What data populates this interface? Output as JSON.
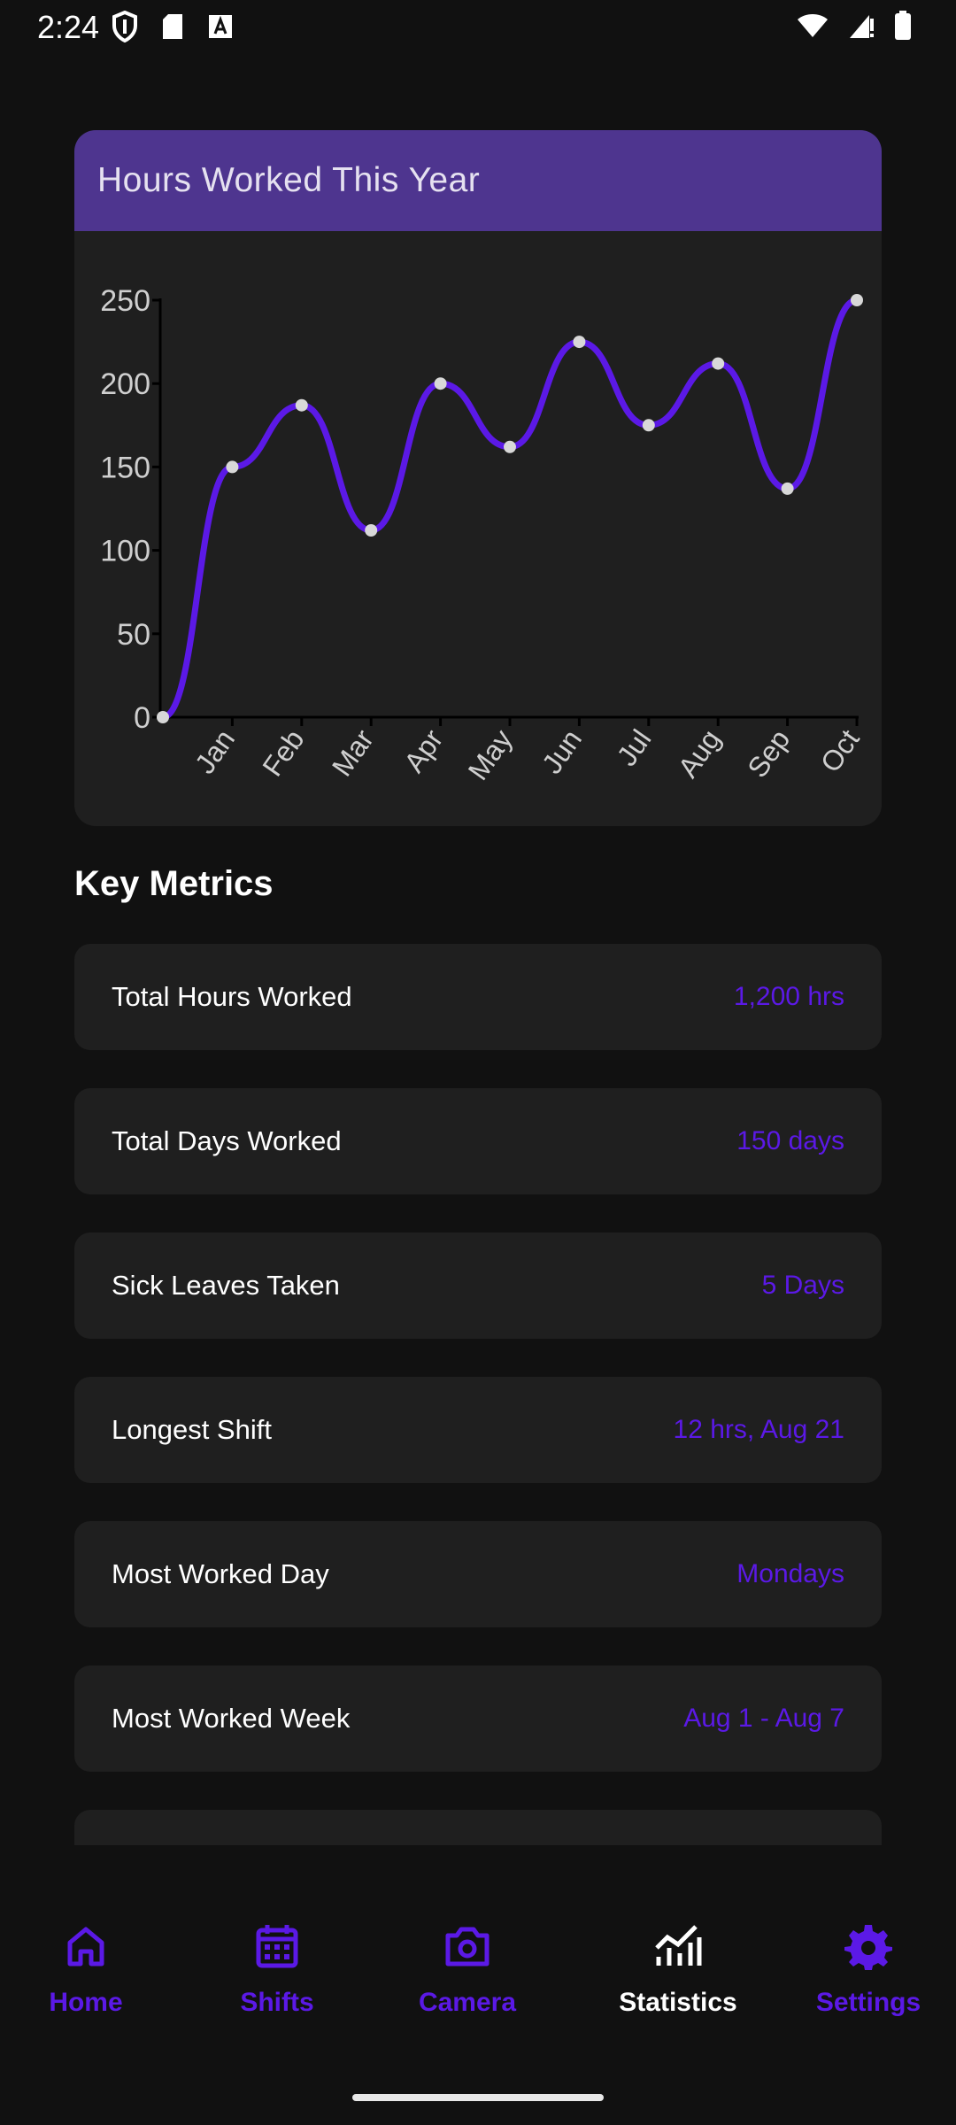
{
  "status_bar": {
    "time": "2:24",
    "left_icons": [
      "shield-icon",
      "sd-card-icon",
      "font-a-icon"
    ],
    "right_icons": [
      "wifi-icon",
      "signal-icon",
      "battery-icon"
    ]
  },
  "chart_card": {
    "title": "Hours Worked This Year",
    "header_color": "#4e358f",
    "line_color": "#5b19e6"
  },
  "chart_data": {
    "type": "line",
    "title": "Hours Worked This Year",
    "categories": [
      "",
      "Jan",
      "Feb",
      "Mar",
      "Apr",
      "May",
      "Jun",
      "Jul",
      "Aug",
      "Sep",
      "Oct"
    ],
    "values": [
      0,
      150,
      187,
      112,
      200,
      162,
      225,
      175,
      212,
      137,
      250
    ],
    "ylim": [
      0,
      250
    ],
    "yticks": [
      "0",
      "50",
      "100",
      "150",
      "200",
      "250"
    ],
    "xlabel": "",
    "ylabel": "",
    "grid": false,
    "smooth": true
  },
  "key_metrics": {
    "title": "Key Metrics",
    "items": [
      {
        "label": "Total Hours Worked",
        "value": "1,200 hrs"
      },
      {
        "label": "Total Days Worked",
        "value": "150 days"
      },
      {
        "label": "Sick Leaves Taken",
        "value": "5 Days"
      },
      {
        "label": "Longest Shift",
        "value": "12 hrs, Aug 21"
      },
      {
        "label": "Most Worked Day",
        "value": "Mondays"
      },
      {
        "label": "Most Worked Week",
        "value": "Aug 1 - Aug 7"
      }
    ]
  },
  "bottom_nav": {
    "items": [
      {
        "label": "Home",
        "icon": "home-icon"
      },
      {
        "label": "Shifts",
        "icon": "calendar-icon"
      },
      {
        "label": "Camera",
        "icon": "camera-icon"
      },
      {
        "label": "Statistics",
        "icon": "chart-icon"
      },
      {
        "label": "Settings",
        "icon": "gear-icon"
      }
    ],
    "active": "Statistics",
    "accent_color": "#5b19e6"
  }
}
